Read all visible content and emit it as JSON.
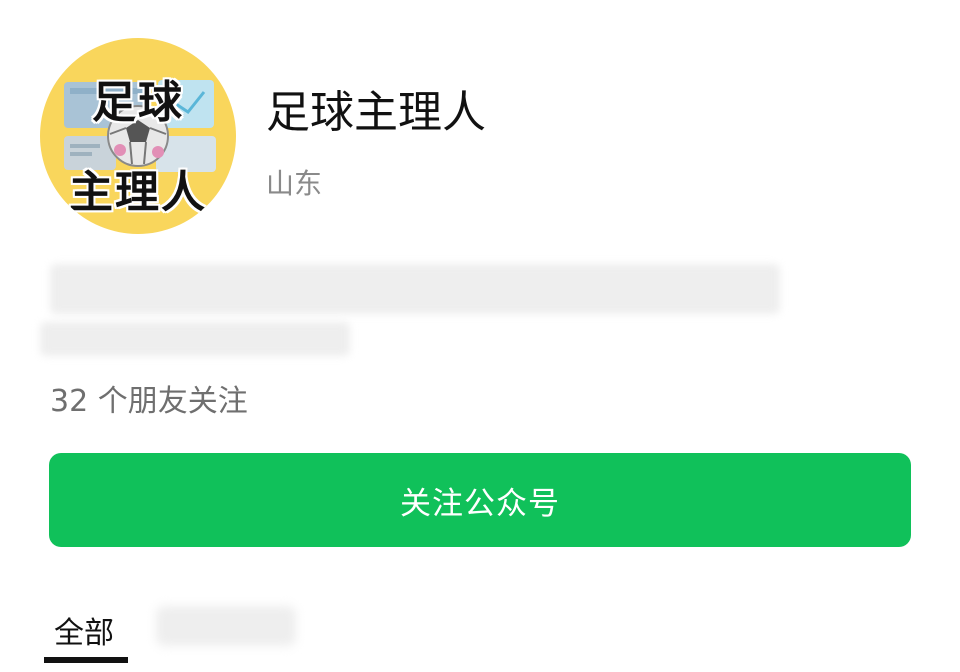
{
  "profile": {
    "avatar_text_line1": "足球",
    "avatar_text_line2": "主理人",
    "name": "足球主理人",
    "region": "山东"
  },
  "friends_following": "32 个朋友关注",
  "follow_button_label": "关注公众号",
  "tabs": [
    {
      "label": "全部",
      "selected": true
    }
  ],
  "colors": {
    "accent_green": "#10c15a",
    "avatar_bg": "#f9d65c"
  }
}
